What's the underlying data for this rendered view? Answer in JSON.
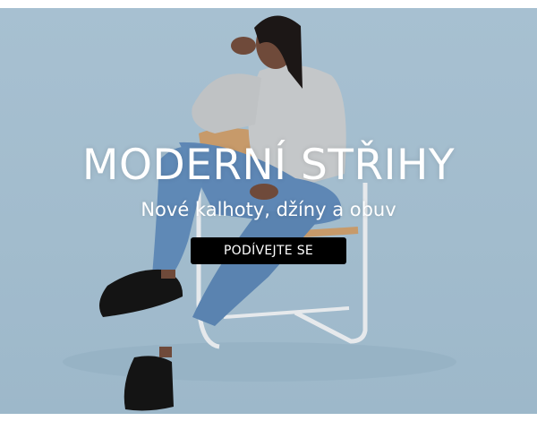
{
  "banner": {
    "headline": "MODERNÍ STŘIHY",
    "subheadline": "Nové kalhoty, džíny a obuv",
    "cta_label": "PODÍVEJTE SE",
    "background_color": "#a7c0d1",
    "cta_color": "#000000",
    "text_color": "#ffffff"
  }
}
